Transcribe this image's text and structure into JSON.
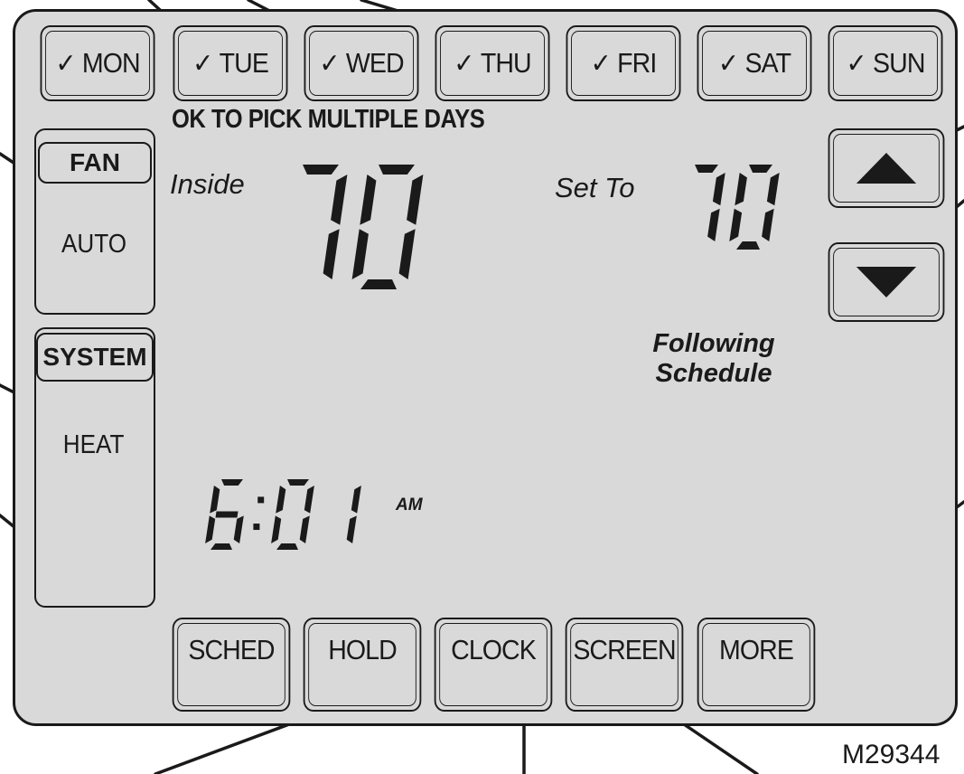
{
  "days": [
    {
      "label": "MON",
      "checked": true
    },
    {
      "label": "TUE",
      "checked": true
    },
    {
      "label": "WED",
      "checked": true
    },
    {
      "label": "THU",
      "checked": true
    },
    {
      "label": "FRI",
      "checked": true
    },
    {
      "label": "SAT",
      "checked": true
    },
    {
      "label": "SUN",
      "checked": true
    }
  ],
  "check_glyph": "✓",
  "hint": "OK TO PICK MULTIPLE DAYS",
  "fan": {
    "label": "FAN",
    "value": "AUTO"
  },
  "system": {
    "label": "SYSTEM",
    "value": "HEAT"
  },
  "inside": {
    "label": "Inside",
    "temp": "70"
  },
  "setpoint": {
    "label": "Set To",
    "temp": "70"
  },
  "status": {
    "line1": "Following",
    "line2": "Schedule"
  },
  "clock": {
    "time": "6:01",
    "ampm": "AM"
  },
  "arrows": {
    "up": "up-arrow-icon",
    "down": "down-arrow-icon"
  },
  "bottom_buttons": [
    "SCHED",
    "HOLD",
    "CLOCK",
    "SCREEN",
    "MORE"
  ],
  "figure_code": "M29344"
}
